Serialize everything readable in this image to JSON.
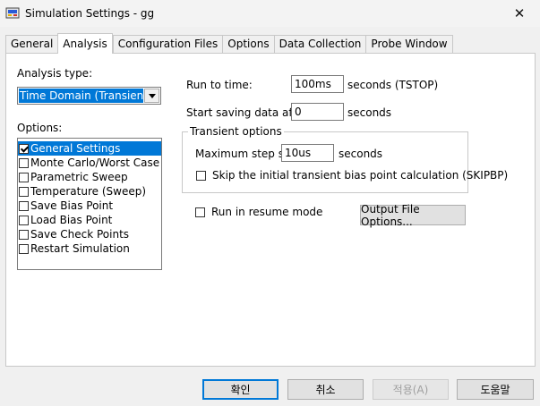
{
  "window": {
    "title": "Simulation Settings - gg",
    "close_glyph": "✕"
  },
  "tabs": [
    {
      "label": "General"
    },
    {
      "label": "Analysis"
    },
    {
      "label": "Configuration Files"
    },
    {
      "label": "Options"
    },
    {
      "label": "Data Collection"
    },
    {
      "label": "Probe Window"
    }
  ],
  "analysis": {
    "analysis_type_label": "Analysis type:",
    "analysis_type_value": "Time Domain (Transient)",
    "options_label": "Options:",
    "options": [
      {
        "label": "General Settings",
        "checked": true
      },
      {
        "label": "Monte Carlo/Worst Case",
        "checked": false
      },
      {
        "label": "Parametric Sweep",
        "checked": false
      },
      {
        "label": "Temperature (Sweep)",
        "checked": false
      },
      {
        "label": "Save Bias Point",
        "checked": false
      },
      {
        "label": "Load Bias Point",
        "checked": false
      },
      {
        "label": "Save Check Points",
        "checked": false
      },
      {
        "label": "Restart Simulation",
        "checked": false
      }
    ],
    "run_to_time_label": "Run to time:",
    "run_to_time_value": "100ms",
    "run_to_time_units": "seconds  (TSTOP)",
    "start_saving_label": "Start saving data after:",
    "start_saving_value": "0",
    "start_saving_units": "seconds",
    "transient_group_title": "Transient options",
    "max_step_label": "Maximum step size:",
    "max_step_value": "10us",
    "max_step_units": "seconds",
    "skip_bias_label": "Skip the initial transient bias point calculation  (SKIPBP)",
    "skip_bias_checked": false,
    "resume_label": "Run in resume mode",
    "resume_checked": false,
    "output_file_button": "Output File Options..."
  },
  "footer": {
    "ok": "확인",
    "cancel": "취소",
    "apply": "적용(A)",
    "help": "도움말"
  },
  "colors": {
    "selection": "#0078d7",
    "window_bg": "#f0f0f0",
    "panel_bg": "#ffffff"
  }
}
